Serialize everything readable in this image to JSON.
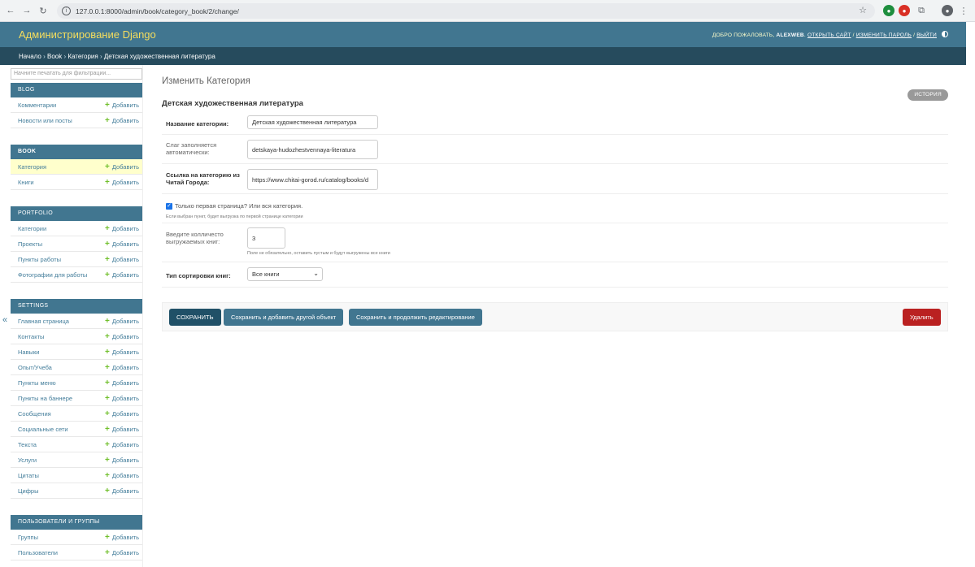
{
  "browser": {
    "url": "127.0.0.1:8000/admin/book/category_book/2/change/"
  },
  "header": {
    "brand": "Администрирование Django",
    "welcome": "ДОБРО ПОЖАЛОВАТЬ,",
    "username": "ALEXWEB",
    "view_site": "ОТКРЫТЬ САЙТ",
    "change_password": "ИЗМЕНИТЬ ПАРОЛЬ",
    "logout": "ВЫЙТИ",
    "sep": " / "
  },
  "breadcrumbs": {
    "home": "Начало",
    "app": "Book",
    "model": "Категория",
    "object": "Детская художественная литература",
    "sep": " › "
  },
  "sidebar": {
    "filter_placeholder": "Начните печатать для фильтрации...",
    "add_label": "Добавить",
    "modules": [
      {
        "caption": "BLOG",
        "items": [
          "Комментарии",
          "Новости или посты"
        ]
      },
      {
        "caption": "BOOK",
        "items": [
          "Категория",
          "Книги"
        ]
      },
      {
        "caption": "PORTFOLIO",
        "items": [
          "Категории",
          "Проекты",
          "Пункты работы",
          "Фотографии для работы"
        ]
      },
      {
        "caption": "SETTINGS",
        "items": [
          "Главная страница",
          "Контакты",
          "Навыки",
          "Опыт/Учеба",
          "Пункты меню",
          "Пункты на баннере",
          "Сообщения",
          "Социальные сети",
          "Текста",
          "Услуги",
          "Цитаты",
          "Цифры"
        ]
      },
      {
        "caption": "ПОЛЬЗОВАТЕЛИ И ГРУППЫ",
        "items": [
          "Группы",
          "Пользователи"
        ]
      }
    ]
  },
  "main": {
    "title": "Изменить Категория",
    "history": "ИСТОРИЯ",
    "object_title": "Детская художественная литература",
    "fields": {
      "name_label": "Название категории:",
      "name_value": "Детская художественная литература",
      "slug_label": "Слаг заполняется автоматически:",
      "slug_value": "detskaya-hudozhestvennaya-literatura",
      "link_label": "Ссылка на категорию из Читай Города:",
      "link_value": "https://www.chitai-gorod.ru/catalog/books/d",
      "first_page_label": "Только первая страница? Или вся категория.",
      "first_page_help": "Если выбран пункт, будет выгрузка по первой странице категории",
      "count_label": "Введите колличесто выгружаемых книг:",
      "count_value": "3",
      "count_help": "Поле не обязательно, оставить пустым и будут выгружены все книги",
      "sort_label": "Тип сортировки книг:",
      "sort_value": "Все книги"
    },
    "buttons": {
      "save": "СОХРАНИТЬ",
      "save_add": "Сохранить и добавить другой объект",
      "save_continue": "Сохранить и продолжить редактирование",
      "delete": "Удалить"
    }
  }
}
